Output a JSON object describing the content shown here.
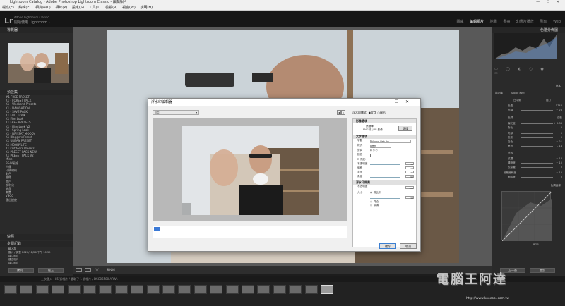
{
  "titlebar": {
    "title": "Lightroom Catalog - Adobe Photoshop Lightroom Classic - 編輯相片"
  },
  "menu": [
    "檔案(F)",
    "編輯(E)",
    "相片庫(L)",
    "相片(P)",
    "設定(S)",
    "工具(T)",
    "檢視(V)",
    "視窗(W)",
    "說明(H)"
  ],
  "identity": {
    "logo": "Lr",
    "catalog_label": "Adobe Lightroom Classic",
    "subtitle": "開始使用 Lightroom ›"
  },
  "modules": [
    "圖庫",
    "編輯相片",
    "地圖",
    "書冊",
    "幻燈片播放",
    "列印",
    "Web"
  ],
  "left_panel": {
    "navigator": "導覽器",
    "presets_header": "預設集",
    "presets": [
      "#1 FREE PRESET",
      "K1 - FOREST PACK",
      "K1 - Weekend Presets",
      "K1 - NAVIGATION",
      "K1 - SAVE PACK",
      "K1 FULL LOOK",
      "K1 Film Look",
      "K1 FREE PRESETS",
      "K1 - Film Look V2",
      "K1 - Spring Look",
      "K1 - DRY-SAT MOODY",
      "K1 Bloggers Preset",
      "K1 URBAN PRESET",
      "K1 MOODYLIFE",
      "K1 Outdoors Presets",
      "K1 PRESET PACK NEW",
      "K1 PRESET PACK V2",
      "Mine",
      "B&W風格",
      "人像",
      "印刷材料",
      "彩色",
      "曲線",
      "黑白",
      "銳利化",
      "暗角",
      "漸暈",
      "VSCO",
      "匯出設定"
    ],
    "snapshots": "快照",
    "history": "步驟記錄",
    "history_items": [
      "輸入為",
      "匯入 / 調整 2020/11/26 下午 10:59",
      "建立相片",
      "建立相片",
      "建立相片"
    ],
    "copy_btn": "拷貝...",
    "paste_btn": "貼上"
  },
  "dialog": {
    "title": "浮水印編輯器",
    "preset_value": "自訂",
    "style_label": "浮水印樣式:",
    "style_text": "文字",
    "style_graphic": "圖形",
    "sections": {
      "image_options": "影像選項",
      "choose_label": "選擇",
      "image_hint1": "請選擇",
      "image_hint2": "PNG 或 JPG 影像",
      "text_options": "文字選項",
      "font_label": "字體",
      "font_value": "Myriad Web Pro",
      "style_label": "樣式",
      "style_value": "標準",
      "align_label": "對齊",
      "color_label": "顏色",
      "shadow_label": "陰影",
      "opacity_label": "不透明度",
      "offset_label": "偏移",
      "radius_label": "半徑",
      "angle_label": "角度",
      "effects": "浮水印效果",
      "wm_opacity": "不透明度",
      "size_label": "大小",
      "size_proportional": "等比例",
      "fit": "符合",
      "fill": "填滿"
    },
    "values": {
      "shadow_opacity": "35",
      "offset": "10",
      "radius": "25",
      "angle": "-90",
      "wm_opacity": "100",
      "size": "16"
    },
    "text_value": "",
    "ok": "儲存",
    "cancel": "取消"
  },
  "right_panel": {
    "histogram": "色階分佈圖",
    "basic": "基本",
    "profile": "描述檔",
    "profile_value": "Adobe 顏色",
    "wb": "白平衡",
    "wb_value": "自訂",
    "temp": "色溫",
    "temp_val": "5748",
    "tint": "色調",
    "tint_val": "+ 28",
    "tone": "色調",
    "tone_auto": "自動",
    "exposure": "曝光度",
    "exposure_val": "+ 0.83",
    "contrast": "對比",
    "contrast_val": "0",
    "highlights": "亮部",
    "highlights_val": "0",
    "shadows": "陰影",
    "shadows_val": "0",
    "whites": "白色",
    "whites_val": "+ 21",
    "blacks": "黑色",
    "blacks_val": "- 14",
    "presence": "外觀",
    "texture": "紋理",
    "texture_val": "+ 16",
    "clarity": "清晰度",
    "clarity_val": "+ 15",
    "dehaze": "去朦朧",
    "dehaze_val": "0",
    "vibrance": "細節飽和度",
    "vibrance_val": "+ 15",
    "saturation": "飽和度",
    "saturation_val": "0",
    "tonecurve": "色調曲線",
    "rgb": "RGB",
    "prev_btn": "上一張",
    "reset_btn": "重設"
  },
  "toolbar": {
    "mode": "軟校樣"
  },
  "filmstrip_bar": {
    "path": "上次匯入  ·  85 張相片 / 選取了 1 張相片 / DSC06580.ARW ›"
  },
  "watermark": {
    "brand": "電腦王阿達",
    "url": "http://www.koocool.com.tw"
  }
}
